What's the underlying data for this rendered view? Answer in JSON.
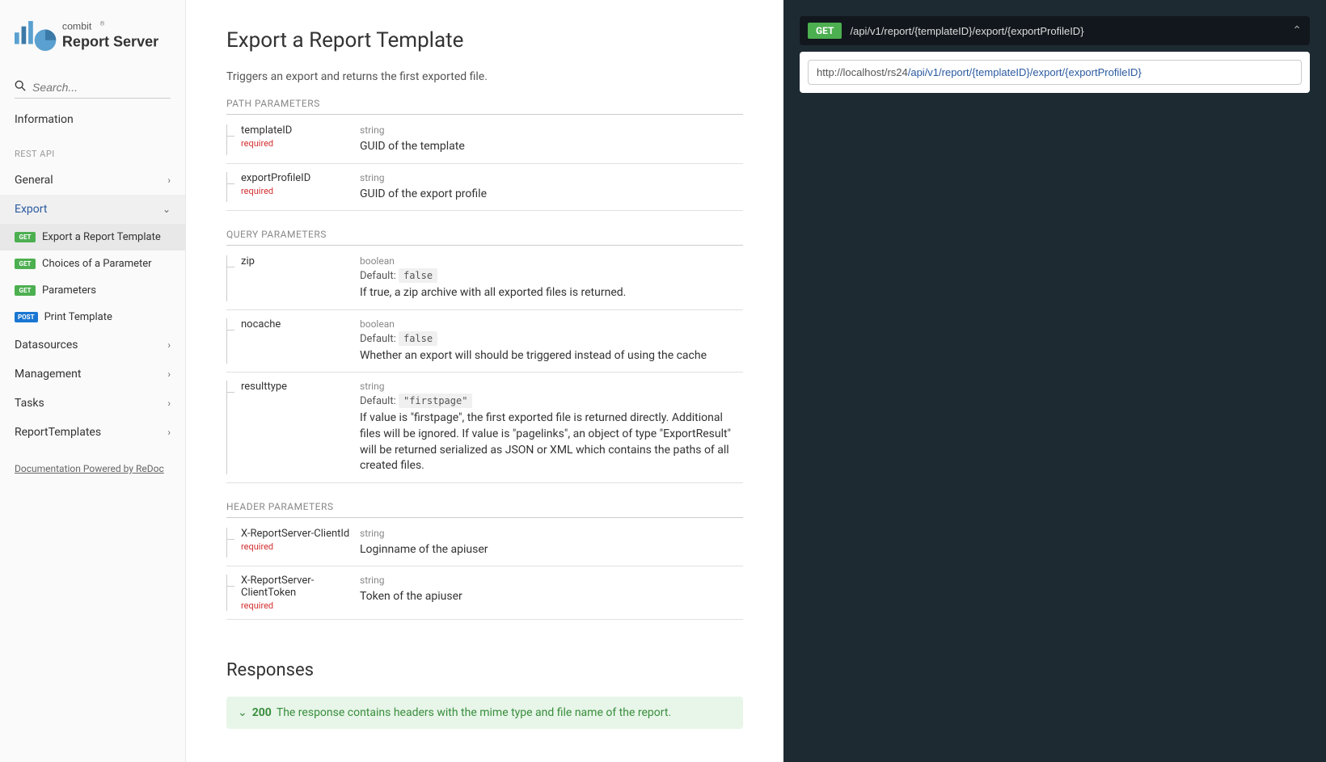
{
  "logo": {
    "company": "combit",
    "product": "Report Server",
    "reg": "®"
  },
  "search": {
    "placeholder": "Search..."
  },
  "sidebar": {
    "top_item": "Information",
    "section_label": "REST API",
    "items": [
      {
        "label": "General"
      },
      {
        "label": "Export",
        "active": true
      },
      {
        "label": "Datasources"
      },
      {
        "label": "Management"
      },
      {
        "label": "Tasks"
      },
      {
        "label": "ReportTemplates"
      }
    ],
    "export_sub": [
      {
        "method": "GET",
        "label": "Export a Report Template",
        "active": true
      },
      {
        "method": "GET",
        "label": "Choices of a Parameter"
      },
      {
        "method": "GET",
        "label": "Parameters"
      },
      {
        "method": "POST",
        "label": "Print Template"
      }
    ],
    "footer": "Documentation Powered by ReDoc"
  },
  "content": {
    "title": "Export a Report Template",
    "description": "Triggers an export and returns the first exported file.",
    "sections": {
      "path": "PATH PARAMETERS",
      "query": "QUERY PARAMETERS",
      "header": "HEADER PARAMETERS"
    },
    "path_params": [
      {
        "name": "templateID",
        "required": "required",
        "type": "string",
        "desc": "GUID of the template"
      },
      {
        "name": "exportProfileID",
        "required": "required",
        "type": "string",
        "desc": "GUID of the export profile"
      }
    ],
    "query_params": [
      {
        "name": "zip",
        "type": "boolean",
        "default_label": "Default:",
        "default": "false",
        "desc": "If true, a zip archive with all exported files is returned."
      },
      {
        "name": "nocache",
        "type": "boolean",
        "default_label": "Default:",
        "default": "false",
        "desc": "Whether an export will should be triggered instead of using the cache"
      },
      {
        "name": "resulttype",
        "type": "string",
        "default_label": "Default:",
        "default": "\"firstpage\"",
        "desc": "If value is \"firstpage\", the first exported file is returned directly. Additional files will be ignored. If value is \"pagelinks\", an object of type \"ExportResult\" will be returned serialized as JSON or XML which contains the paths of all created files."
      }
    ],
    "header_params": [
      {
        "name": "X-ReportServer-ClientId",
        "required": "required",
        "type": "string",
        "desc": "Loginname of the apiuser"
      },
      {
        "name": "X-ReportServer-ClientToken",
        "required": "required",
        "type": "string",
        "desc": "Token of the apiuser"
      }
    ],
    "responses_title": "Responses",
    "response": {
      "code": "200",
      "text": "The response contains headers with the mime type and file name of the report."
    }
  },
  "right": {
    "method": "GET",
    "path": "/api/v1/report/{templateID}/export/{exportProfileID}",
    "url_base": "http://localhost/rs24",
    "url_ep": "/api/v1/report/{templateID}/export/{exportProfileID}"
  }
}
